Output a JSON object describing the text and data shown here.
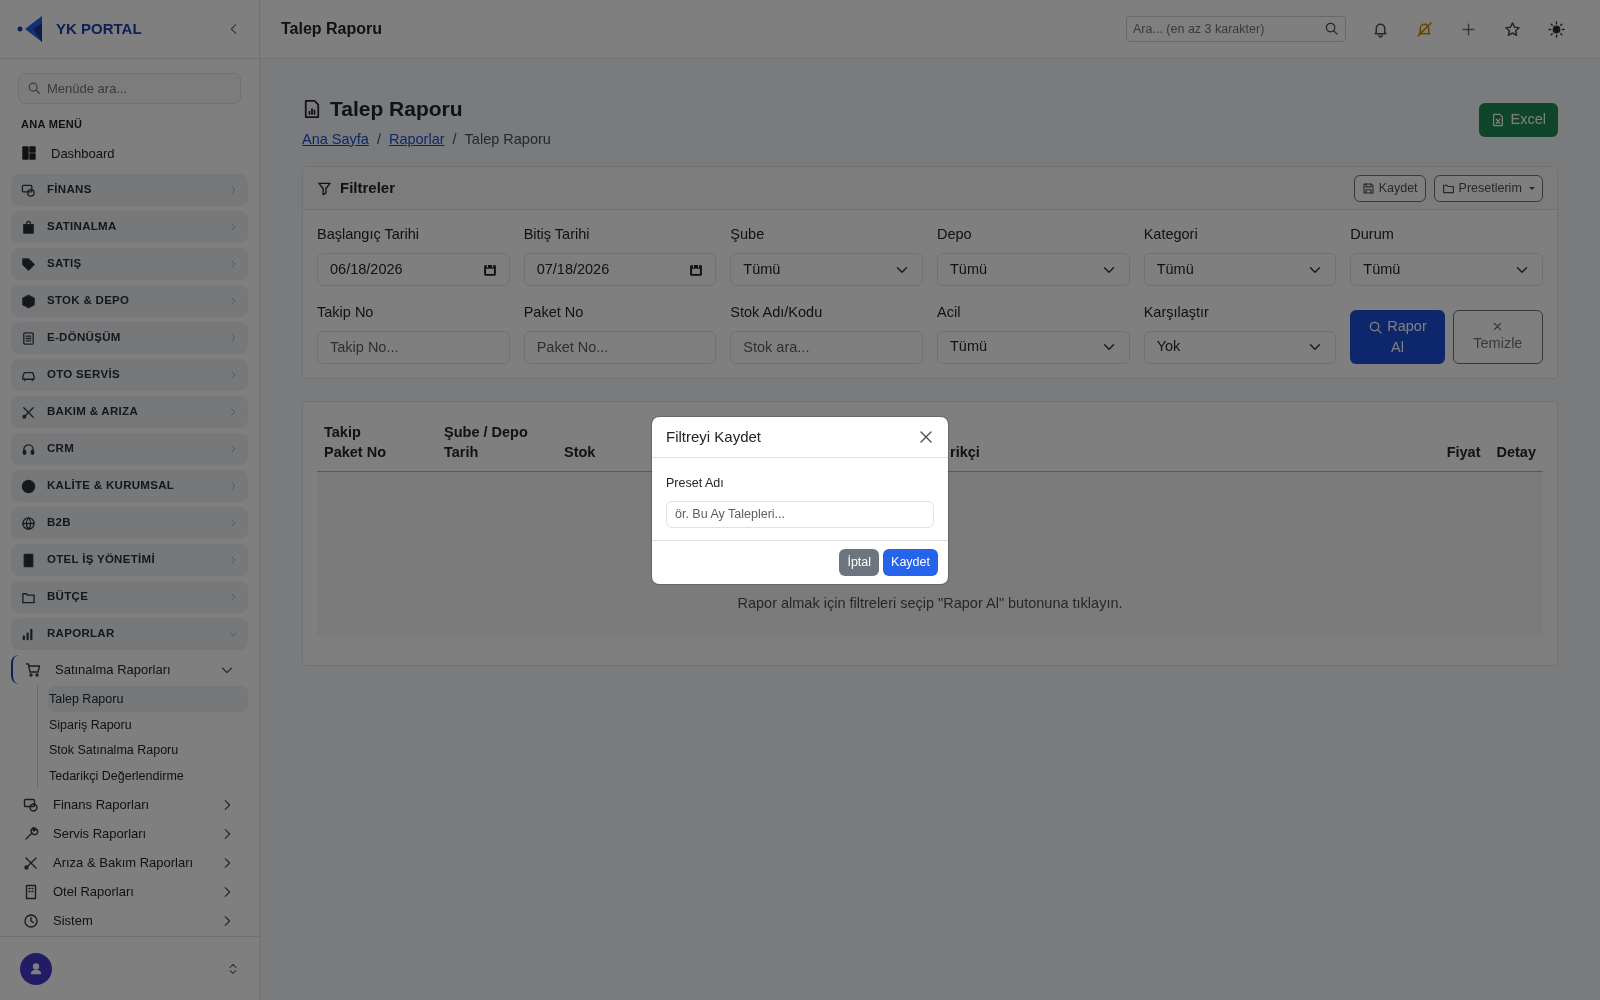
{
  "sidebar": {
    "brand": "YK PORTAL",
    "search": {
      "placeholder": "Menüde ara..."
    },
    "section_label": "ANA MENÜ",
    "items": [
      {
        "kind": "link",
        "label": "Dashboard"
      },
      {
        "kind": "group",
        "label": "FİNANS",
        "expanded": false
      },
      {
        "kind": "group",
        "label": "SATINALMA",
        "expanded": false
      },
      {
        "kind": "group",
        "label": "SATIŞ",
        "expanded": false
      },
      {
        "kind": "group",
        "label": "STOK & DEPO",
        "expanded": false
      },
      {
        "kind": "group",
        "label": "E-DÖNÜŞÜM",
        "expanded": false
      },
      {
        "kind": "group",
        "label": "OTO SERVİS",
        "expanded": false
      },
      {
        "kind": "group",
        "label": "BAKIM & ARIZA",
        "expanded": false
      },
      {
        "kind": "group",
        "label": "CRM",
        "expanded": false
      },
      {
        "kind": "group",
        "label": "KALİTE & KURUMSAL",
        "expanded": false
      },
      {
        "kind": "group",
        "label": "B2B",
        "expanded": false
      },
      {
        "kind": "group",
        "label": "OTEL İŞ YÖNETİMİ",
        "expanded": false
      },
      {
        "kind": "group",
        "label": "BÜTÇE",
        "expanded": false
      },
      {
        "kind": "group",
        "label": "RAPORLAR",
        "expanded": true,
        "children": [
          {
            "label": "Satınalma Raporları",
            "expanded": true,
            "children": [
              {
                "label": "Talep Raporu",
                "selected": true
              },
              {
                "label": "Sipariş Raporu",
                "selected": false
              },
              {
                "label": "Stok Satınalma Raporu",
                "selected": false
              },
              {
                "label": "Tedarikçi Değerlendirme",
                "selected": false
              }
            ]
          },
          {
            "label": "Finans Raporları",
            "expanded": false
          },
          {
            "label": "Servis Raporları",
            "expanded": false
          },
          {
            "label": "Arıza & Bakım Raporları",
            "expanded": false
          },
          {
            "label": "Otel Raporları",
            "expanded": false
          },
          {
            "label": "Sistem",
            "expanded": false
          }
        ]
      }
    ]
  },
  "topbar": {
    "title": "Talep Raporu",
    "search": {
      "placeholder": "Ara... (en az 3 karakter)"
    }
  },
  "page": {
    "title": "Talep Raporu",
    "breadcrumb": [
      {
        "kind": "link",
        "label": "Ana Sayfa"
      },
      {
        "kind": "separator",
        "label": "/"
      },
      {
        "kind": "link",
        "label": "Raporlar"
      },
      {
        "kind": "separator",
        "label": "/"
      },
      {
        "kind": "current",
        "label": "Talep Raporu"
      }
    ],
    "excel_button": "Excel"
  },
  "filters": {
    "title": "Filtreler",
    "save_button": "Kaydet",
    "presets_button": "Presetlerim",
    "fields": [
      {
        "kind": "date",
        "label": "Başlangıç Tarihi",
        "value": "06/18/2026"
      },
      {
        "kind": "date",
        "label": "Bitiş Tarihi",
        "value": "07/18/2026"
      },
      {
        "kind": "select",
        "label": "Şube",
        "value": "Tümü"
      },
      {
        "kind": "select",
        "label": "Depo",
        "value": "Tümü"
      },
      {
        "kind": "select",
        "label": "Kategori",
        "value": "Tümü"
      },
      {
        "kind": "select",
        "label": "Durum",
        "value": "Tümü"
      },
      {
        "kind": "text",
        "label": "Takip No",
        "placeholder": "Takip No..."
      },
      {
        "kind": "text",
        "label": "Paket No",
        "placeholder": "Paket No..."
      },
      {
        "kind": "text",
        "label": "Stok Adı/Kodu",
        "placeholder": "Stok ara..."
      },
      {
        "kind": "select",
        "label": "Acil",
        "value": "Tümü"
      },
      {
        "kind": "select",
        "label": "Karşılaştır",
        "value": "Yok"
      }
    ],
    "search_button": "Rapor Al",
    "clear_button": "Temizle"
  },
  "results": {
    "columns": [
      {
        "lines": [
          "Takip",
          "Paket No"
        ]
      },
      {
        "lines": [
          "Şube / Depo",
          "Tarih"
        ]
      },
      {
        "lines": [
          "Stok"
        ]
      },
      {
        "lines": [
          "rikçi"
        ]
      },
      {
        "lines": [
          "Fiyat"
        ]
      },
      {
        "lines": [
          "Detay"
        ]
      }
    ],
    "empty_message": "Rapor almak için filtreleri seçip \"Rapor Al\" butonuna tıklayın."
  },
  "modal": {
    "title": "Filtreyi Kaydet",
    "field_label": "Preset Adı",
    "placeholder": "ör. Bu Ay Talepleri...",
    "cancel_button": "İptal",
    "save_button": "Kaydet"
  }
}
